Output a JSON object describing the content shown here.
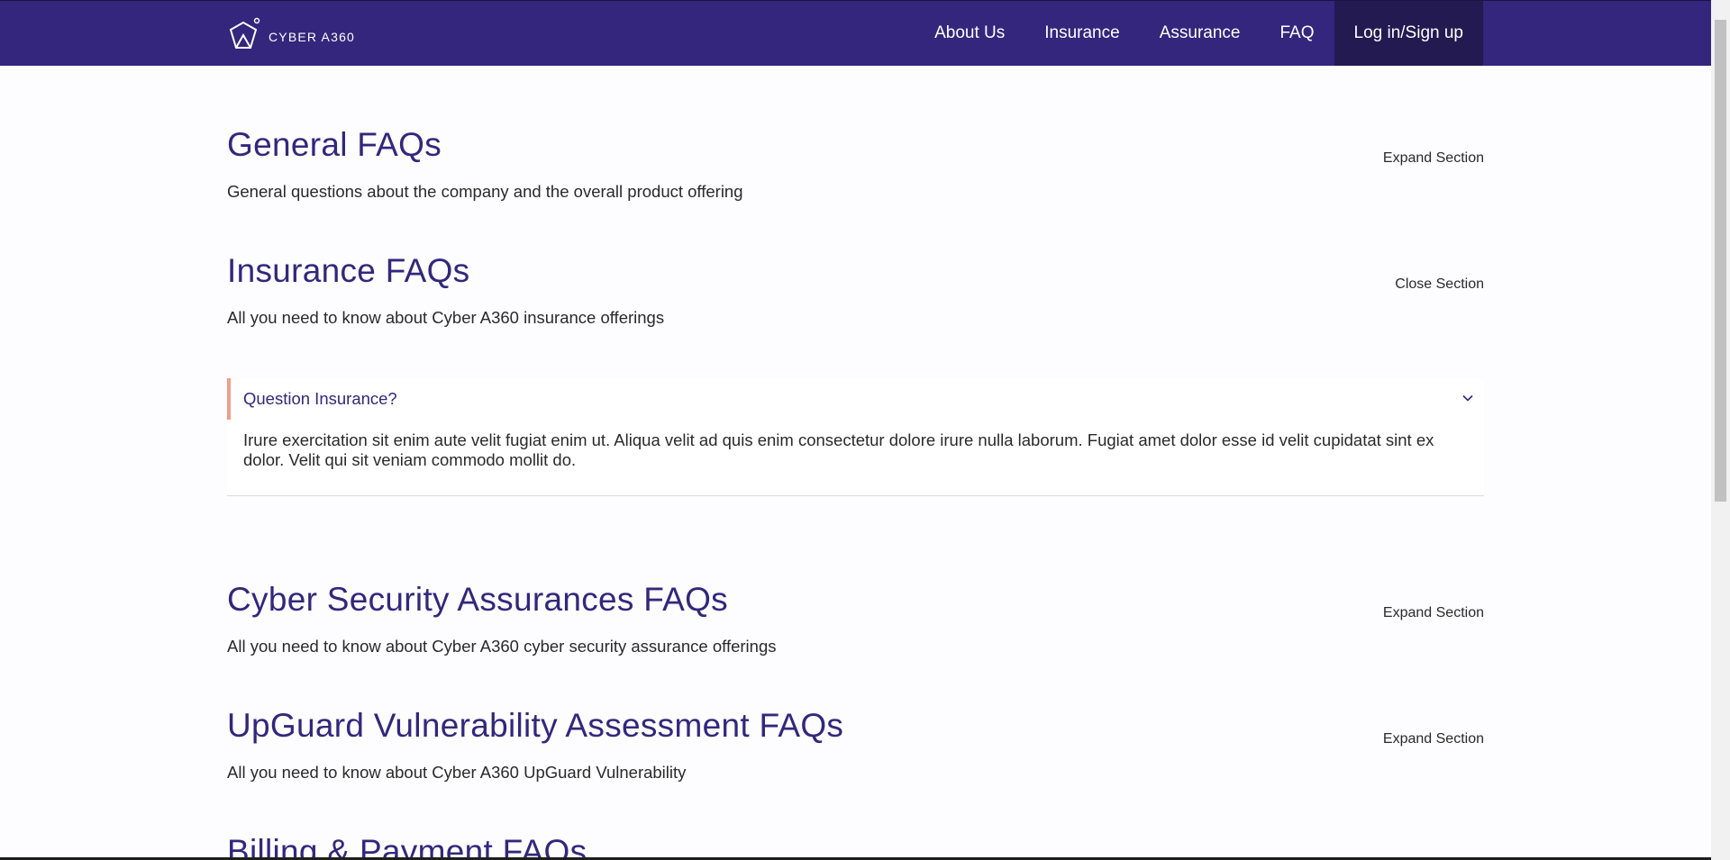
{
  "brand": {
    "name": "CYBER A360",
    "accent": "#34267c",
    "highlight": "#ee9e8b"
  },
  "nav": {
    "about": "About Us",
    "insurance": "Insurance",
    "assurance": "Assurance",
    "faq": "FAQ",
    "login": "Log in/Sign up"
  },
  "sections": [
    {
      "title": "General FAQs",
      "description": "General questions about the company and the overall product offering",
      "toggle": "Expand Section"
    },
    {
      "title": "Insurance FAQs",
      "description": "All you need to know about Cyber A360 insurance offerings",
      "toggle": "Close Section"
    },
    {
      "title": "Cyber Security Assurances FAQs",
      "description": "All you need to know about Cyber A360 cyber security assurance offerings",
      "toggle": "Expand Section"
    },
    {
      "title": "UpGuard Vulnerability Assessment FAQs",
      "description": "All you need to know about Cyber A360 UpGuard Vulnerability",
      "toggle": "Expand Section"
    },
    {
      "title": "Billing & Payment FAQs"
    }
  ],
  "insurance_faq": {
    "question": "Question Insurance?",
    "answer": "Irure exercitation sit enim aute velit fugiat enim ut. Aliqua velit ad quis enim consectetur dolore irure nulla laborum. Fugiat amet dolor esse id velit cupidatat sint ex dolor. Velit qui sit veniam commodo mollit do.",
    "icon": "chevron-down-icon"
  }
}
